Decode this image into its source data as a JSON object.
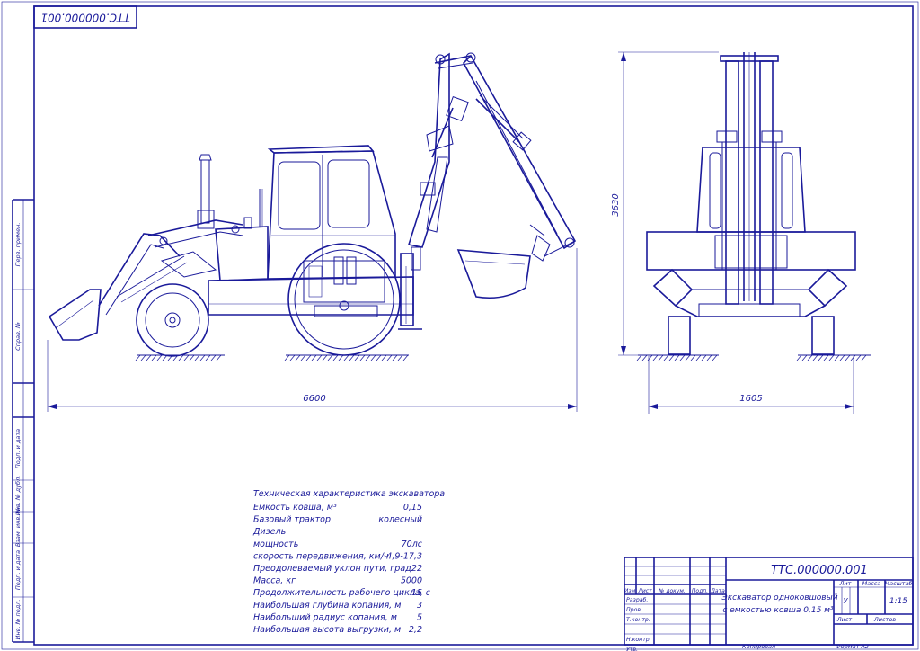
{
  "frame_code": "ТТС.000000.001",
  "title_block": {
    "code": "ТТС.000000.001",
    "name_line1": "Экскаватор одноковшовый",
    "name_line2": "с емкостью ковша 0,15 м³",
    "headers": {
      "lit": "Лит",
      "mass": "Масса",
      "scale": "Масштаб"
    },
    "lit_value": "У",
    "scale_value": "1:15",
    "sheet_label": "Лист",
    "sheets_label": "Листов",
    "col_headers": [
      "Изм",
      "Лист",
      "№ докум.",
      "Подп.",
      "Дата"
    ],
    "rows": [
      "Разраб.",
      "Пров.",
      "Т.контр.",
      "",
      "Н.контр.",
      "Утв."
    ],
    "copied": "Копировал",
    "format": "Формат  А2"
  },
  "side_stamps": [
    "Перв. примен.",
    "Справ. №",
    "Подп. и дата",
    "Инв. № дубл.",
    "Взам. инв. №",
    "Подп. и дата",
    "Инв. № подл."
  ],
  "dimensions": {
    "length": "6600",
    "height": "3630",
    "width": "1605"
  },
  "specs": {
    "title": "Техническая характеристика экскаватора",
    "rows": [
      {
        "label": "Емкость ковша, м³",
        "value": "0,15"
      },
      {
        "label": "Базовый трактор",
        "value": "колесный"
      },
      {
        "label": "Дизель",
        "value": ""
      },
      {
        "label": "мощность",
        "value": "70лс"
      },
      {
        "label": "скорость передвижения, км/ч",
        "value": "4,9-17,3"
      },
      {
        "label": "Преодолеваемый уклон пути, град",
        "value": "22"
      },
      {
        "label": "Масса, кг",
        "value": "5000"
      },
      {
        "label": "Продолжительность рабочего цикла, с",
        "value": "15"
      },
      {
        "label": "Наибольшая глубина копания, м",
        "value": "3"
      },
      {
        "label": "Наибольший радиус копания, м",
        "value": "5"
      },
      {
        "label": "Наибольшая высота выгрузки, м",
        "value": "2,2"
      }
    ]
  },
  "colors": {
    "ink": "#1a1a9a",
    "paper": "#ffffff"
  }
}
